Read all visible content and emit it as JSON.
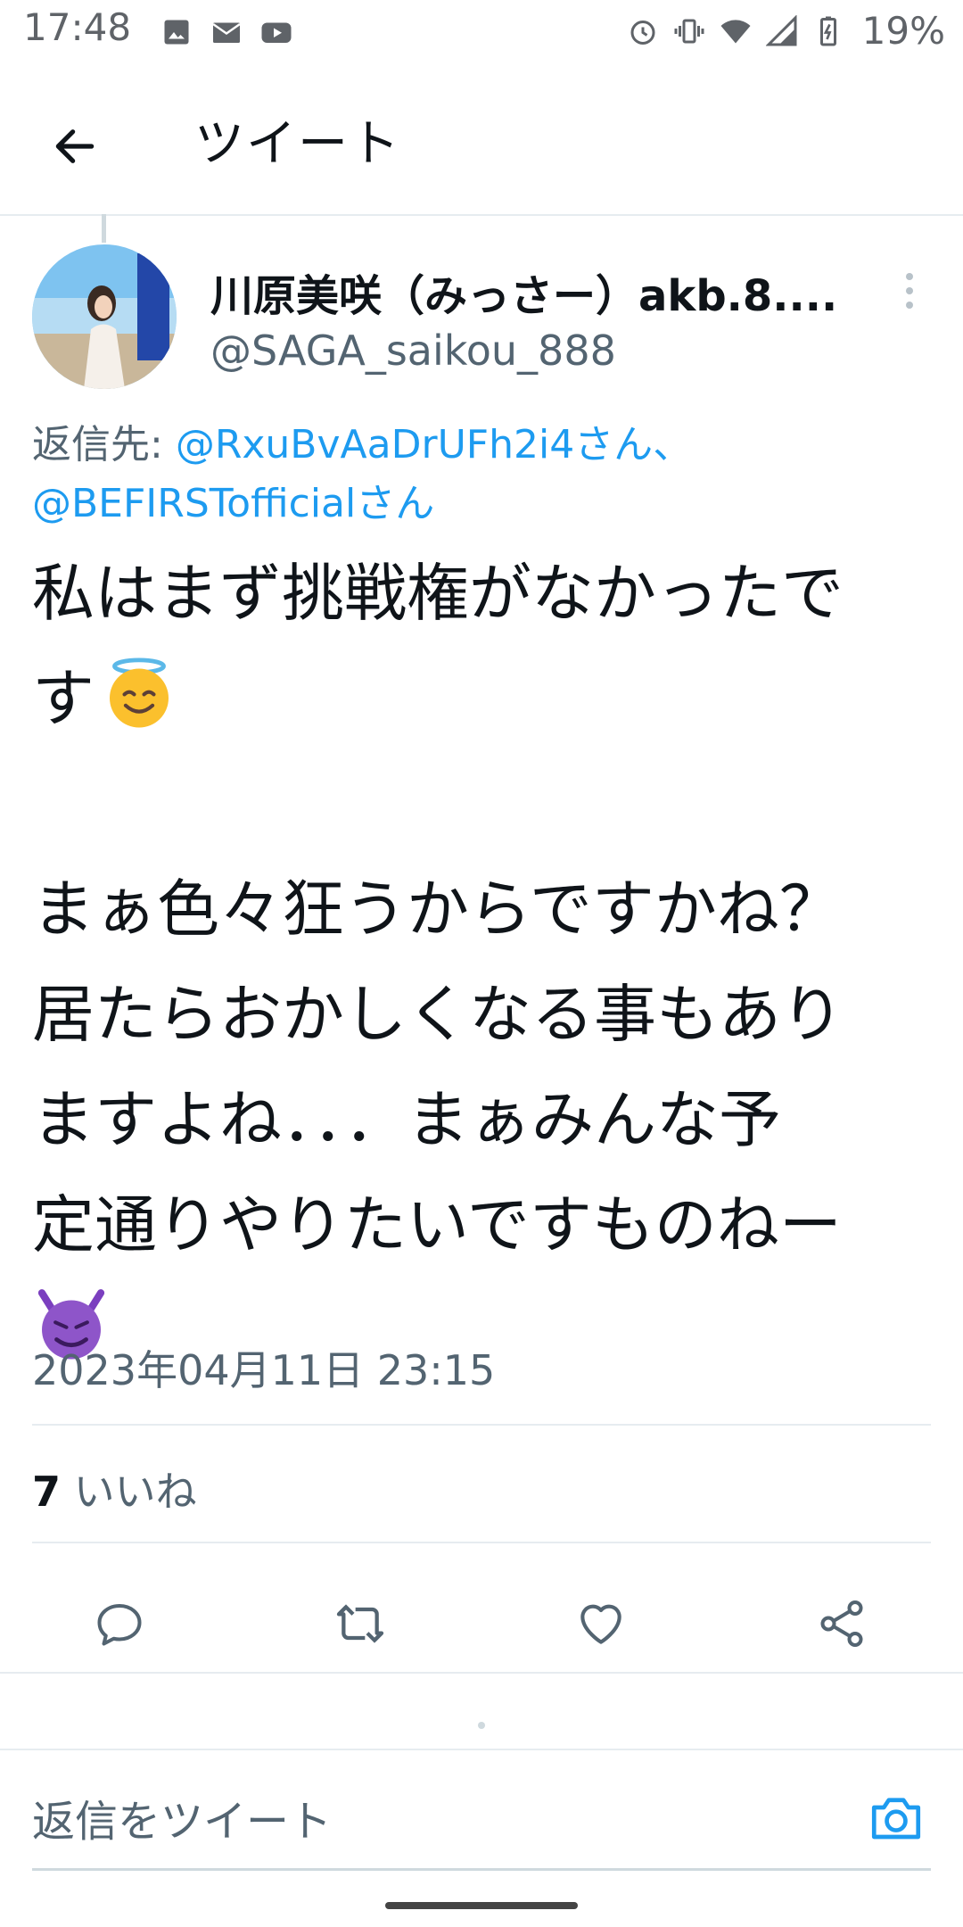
{
  "status_bar": {
    "time": "17:48",
    "left_icons": [
      "image-icon",
      "mail-icon",
      "youtube-icon"
    ],
    "right_icons": [
      "alarm-icon",
      "vibrate-icon",
      "wifi-icon",
      "signal-icon",
      "battery-icon"
    ],
    "battery_percent": "19%"
  },
  "header": {
    "title": "ツイート"
  },
  "tweet": {
    "display_name": "川原美咲（みっさー）akb.8....",
    "handle": "@SAGA_saikou_888",
    "reply_prefix": "返信先: ",
    "reply_mention_1": "@RxuBvAaDrUFh2i4さん",
    "reply_separator": "、",
    "reply_mention_2": "@BEFIRSTofficialさん",
    "text_lines": {
      "l1": "私はまず挑戦権がなかったで",
      "l2": "す",
      "l3": "まぁ色々狂うからですかね？",
      "l4": "居たらおかしくなる事もあり",
      "l5": "ますよね．．．まぁみんな予",
      "l6": "定通りやりたいですものねー"
    },
    "emojis": [
      "smiling-face-with-halo",
      "smiling-face-with-horns"
    ],
    "timestamp": "2023年04月11日 23:15",
    "likes_count": "7",
    "likes_label": " いいね"
  },
  "reply_box": {
    "placeholder": "返信をツイート"
  },
  "colors": {
    "accent": "#1d9bf0",
    "text": "#0f1419",
    "secondary": "#536471",
    "divider": "#e6ecf0"
  }
}
